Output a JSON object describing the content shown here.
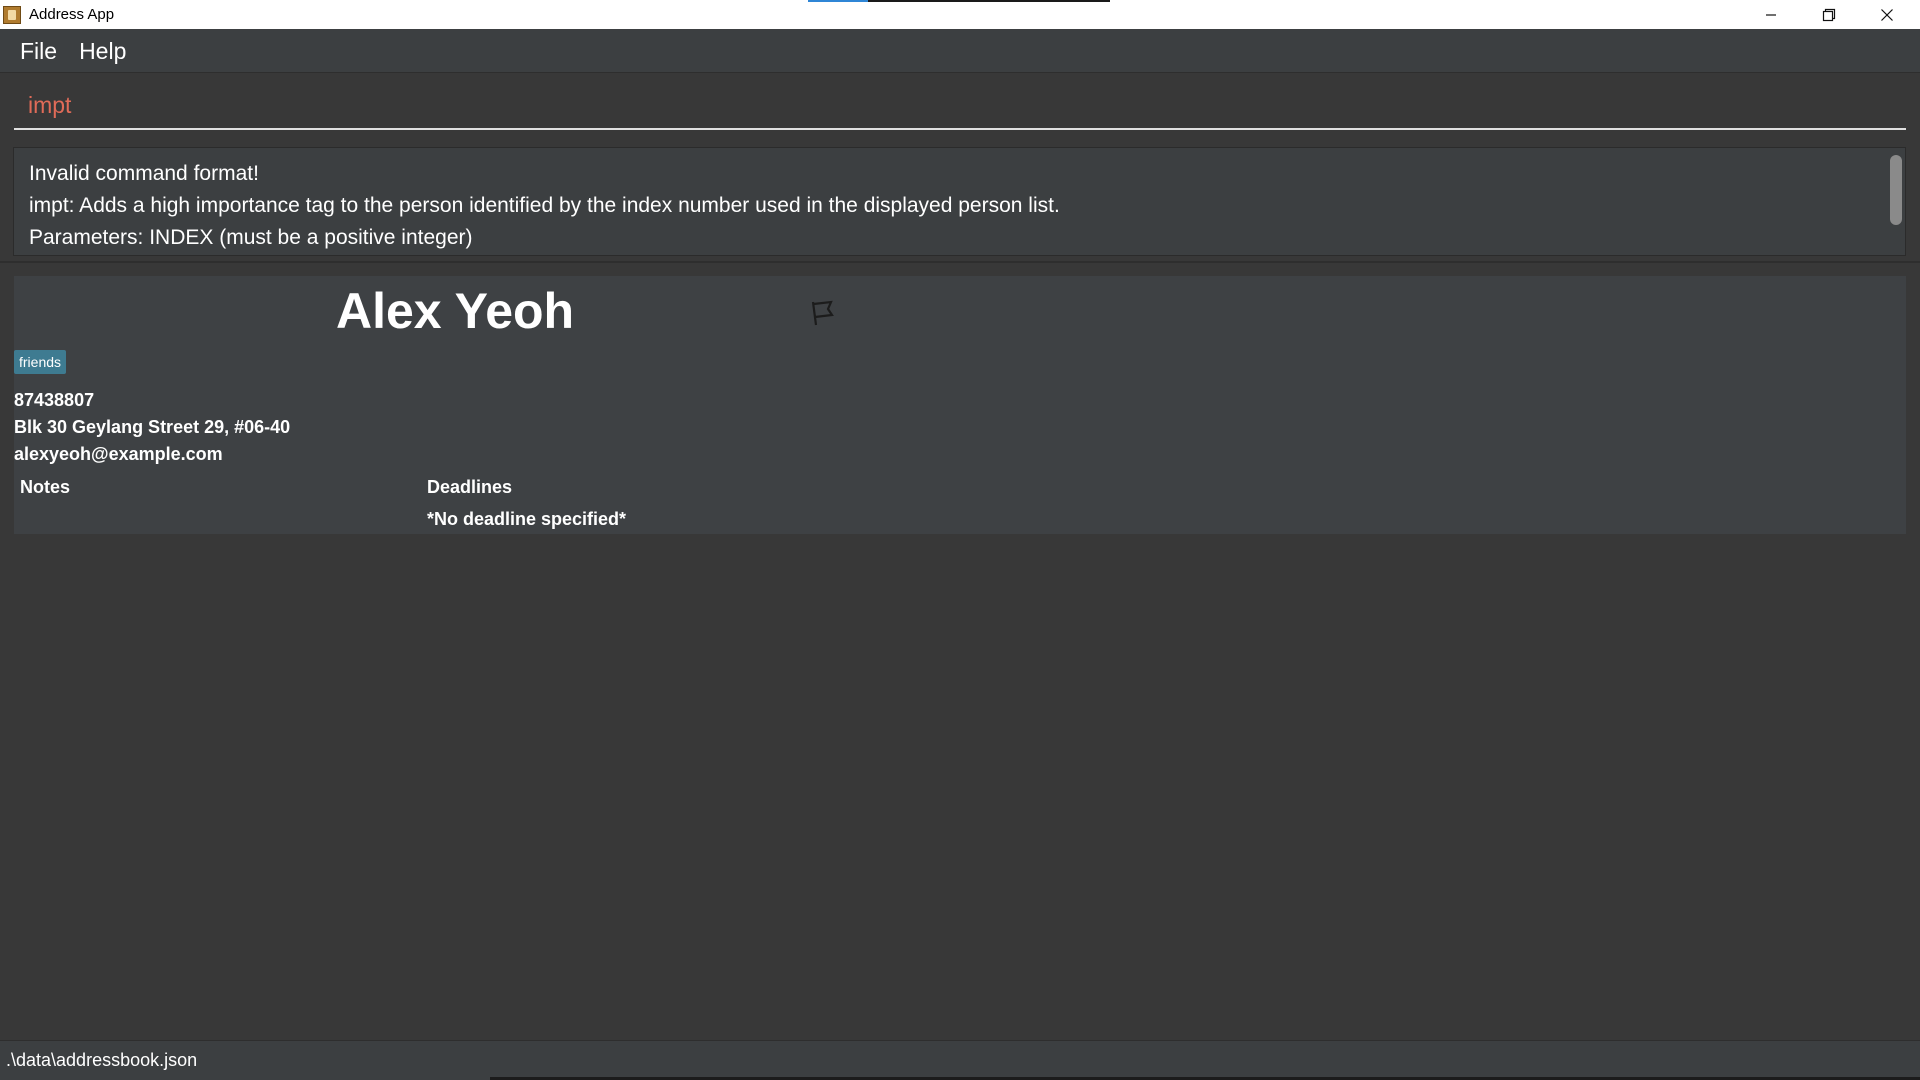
{
  "window": {
    "title": "Address App",
    "progress": 0.2,
    "icons": {
      "app": "address-book-icon",
      "minimize": "minimize-icon",
      "maximize": "restore-icon",
      "close": "close-icon"
    }
  },
  "menu": {
    "items": [
      {
        "label": "File"
      },
      {
        "label": "Help"
      }
    ]
  },
  "command": {
    "value": "impt",
    "text_color": "#e06b58"
  },
  "result": {
    "lines": [
      "Invalid command format!",
      "impt: Adds a high importance tag to the person identified by the index number used in the displayed person list.",
      "Parameters: INDEX (must be a positive integer)"
    ]
  },
  "person": {
    "name": "Alex Yeoh",
    "flag_icon": "flag-icon",
    "tags": [
      "friends"
    ],
    "tag_color": "#3e7b91",
    "phone": "87438807",
    "address": "Blk 30 Geylang Street 29, #06-40",
    "email": "alexyeoh@example.com",
    "notes_label": "Notes",
    "deadlines_label": "Deadlines",
    "deadline_empty": "*No deadline specified*"
  },
  "status": {
    "file_path": ".\\data\\addressbook.json"
  },
  "colors": {
    "background": "#383838",
    "panel": "#3c3f41",
    "card": "#3e4144"
  }
}
